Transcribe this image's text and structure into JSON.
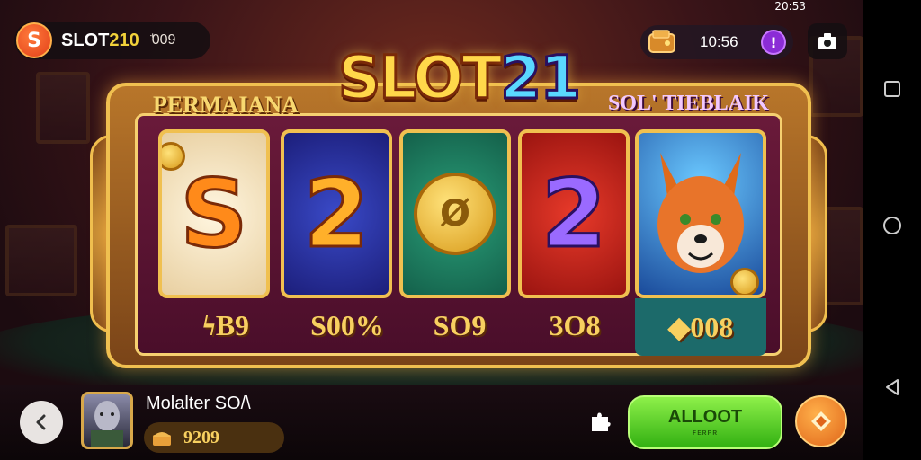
{
  "status_bar": {
    "time": "20:53"
  },
  "brand": {
    "name_prefix": "SLOT",
    "name_suffix": "210",
    "count": "ꜗ009",
    "logo_letter": "S"
  },
  "wallet": {
    "time": "10:56",
    "info_glyph": "!"
  },
  "game": {
    "logo_prefix": "SLOT",
    "logo_number": "21",
    "headline_left": "PERMAIANA",
    "headline_right": "SOL' TIEBLAIK",
    "reels": [
      {
        "symbol": "S",
        "value": "ϟB9"
      },
      {
        "symbol": "2",
        "value": "S00%"
      },
      {
        "symbol": "Ø",
        "value": "SO9"
      },
      {
        "symbol": "2",
        "value": "3O8"
      },
      {
        "symbol": "fox",
        "value": "◆008"
      }
    ]
  },
  "player": {
    "name": "Molalter SO/\\",
    "balance": "9209"
  },
  "actions": {
    "spin_label": "ALLOOT",
    "spin_sub": "ꜰᴇʀᴘʀ"
  },
  "icons": [
    "back-arrow-icon",
    "puzzle-icon",
    "boost-icon",
    "camera-icon",
    "wallet-icon",
    "info-icon"
  ],
  "colors": {
    "spin_green": "#4cc81e",
    "accent_gold": "#f0c050",
    "info_purple": "#8b2cd6",
    "boost_orange": "#e0661a"
  }
}
